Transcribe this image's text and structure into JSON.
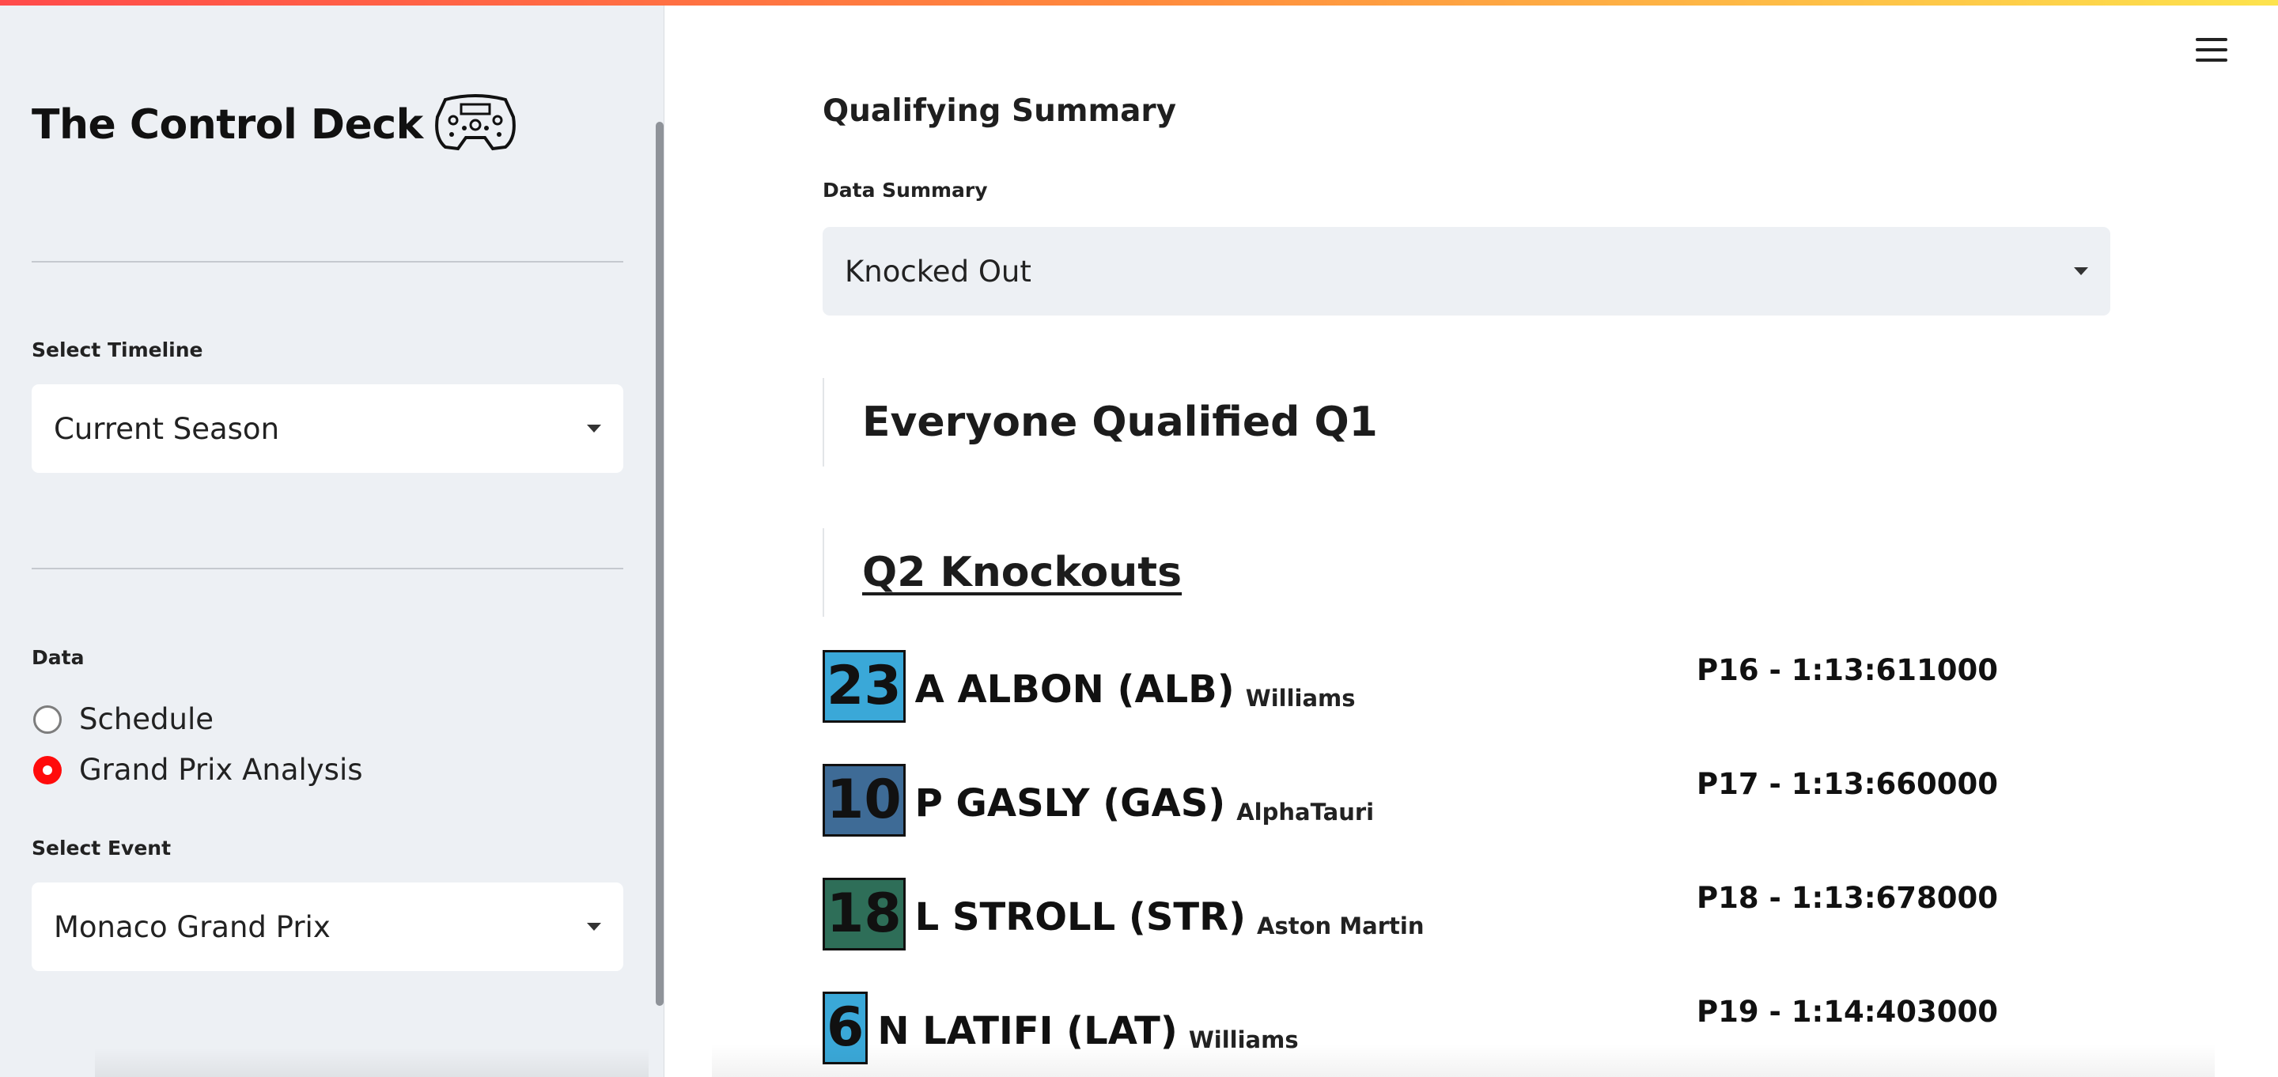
{
  "sidebar": {
    "app_title": "The Control Deck",
    "logo_icon": "steering-wheel-icon",
    "timeline_label": "Select Timeline",
    "timeline_value": "Current Season",
    "data_label": "Data",
    "data_options": [
      "Schedule",
      "Grand Prix Analysis"
    ],
    "data_selected": "Grand Prix Analysis",
    "event_label": "Select Event",
    "event_value": "Monaco Grand Prix"
  },
  "main": {
    "heading": "Qualifying Summary",
    "summary_label": "Data Summary",
    "summary_value": "Knocked Out",
    "q1_title": "Everyone Qualified Q1",
    "q2_title": "Q2 Knockouts",
    "drivers": [
      {
        "number": "23",
        "name": "A ALBON (ALB)",
        "team": "Williams",
        "result": "P16 - 1:13:611000",
        "color": "#3aa8d8"
      },
      {
        "number": "10",
        "name": "P GASLY (GAS)",
        "team": "AlphaTauri",
        "result": "P17 - 1:13:660000",
        "color": "#3e6b96"
      },
      {
        "number": "18",
        "name": "L STROLL (STR)",
        "team": "Aston Martin",
        "result": "P18 - 1:13:678000",
        "color": "#2e6e58"
      },
      {
        "number": "6",
        "name": "N LATIFI (LAT)",
        "team": "Williams",
        "result": "P19 - 1:14:403000",
        "color": "#3aa8d8"
      }
    ]
  },
  "colors": {
    "accent": "#ff0b0b",
    "sidebar_bg": "#edf0f4"
  }
}
